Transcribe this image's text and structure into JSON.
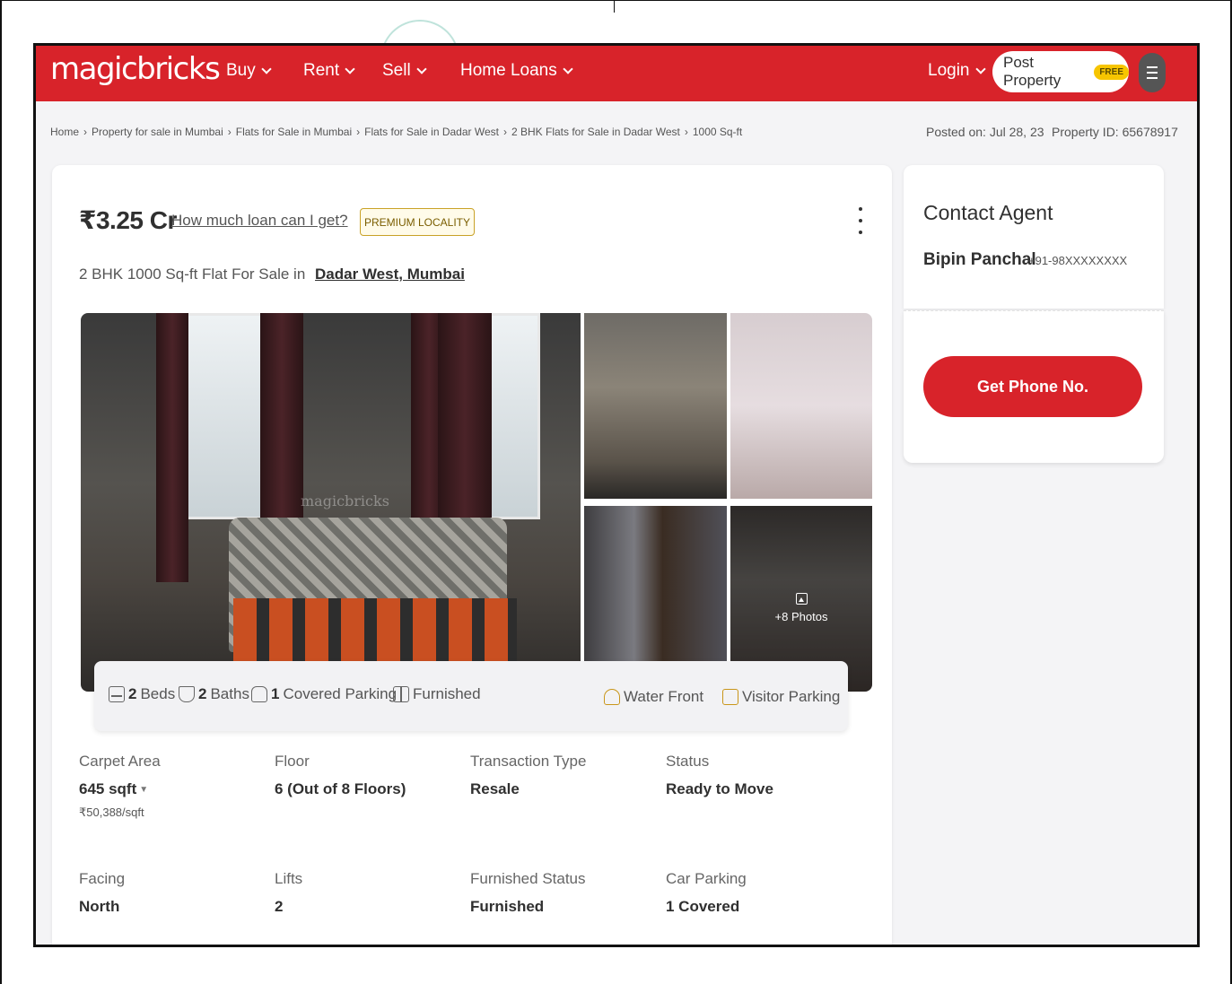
{
  "header": {
    "logo": "magicbricks",
    "nav": [
      "Buy",
      "Rent",
      "Sell",
      "Home Loans"
    ],
    "login": "Login",
    "post_property": "Post Property",
    "free_badge": "FREE"
  },
  "breadcrumb": {
    "items": [
      "Home",
      "Property for sale in Mumbai",
      "Flats for Sale in Mumbai",
      "Flats for Sale in Dadar West",
      "2 BHK Flats for Sale in Dadar West",
      "1000 Sq-ft"
    ],
    "separator": "›"
  },
  "meta": {
    "posted_on": "Posted on: Jul 28, 23",
    "property_id": "Property ID: 65678917"
  },
  "listing": {
    "price": "₹3.25 Cr",
    "loan_link": "How much loan can I get?",
    "premium_badge": "PREMIUM LOCALITY",
    "subtitle": "2 BHK 1000 Sq-ft Flat For Sale in",
    "location": "Dadar West, Mumbai"
  },
  "gallery": {
    "watermark": "magicbricks",
    "more_photos": "+8 Photos"
  },
  "amenities": {
    "beds_count": "2",
    "beds_label": "Beds",
    "baths_count": "2",
    "baths_label": "Baths",
    "parking_count": "1",
    "parking_label": "Covered Parking",
    "furnished": "Furnished",
    "water_front": "Water Front",
    "visitor_parking": "Visitor Parking"
  },
  "specs": [
    {
      "label": "Carpet Area",
      "value": "645 sqft",
      "sub": "₹50,388/sqft"
    },
    {
      "label": "Floor",
      "value": "6 (Out of 8 Floors)"
    },
    {
      "label": "Transaction Type",
      "value": "Resale"
    },
    {
      "label": "Status",
      "value": "Ready to Move"
    },
    {
      "label": "Facing",
      "value": "North"
    },
    {
      "label": "Lifts",
      "value": "2"
    },
    {
      "label": "Furnished Status",
      "value": "Furnished"
    },
    {
      "label": "Car Parking",
      "value": "1 Covered"
    }
  ],
  "contact": {
    "title": "Contact Agent",
    "agent_name": "Bipin Panchal",
    "agent_phone": "+91-98XXXXXXXX",
    "phone_button": "Get Phone No."
  },
  "colors": {
    "brand_red": "#d8232a",
    "free_badge": "#f7c500",
    "premium_border": "#c9a227"
  }
}
